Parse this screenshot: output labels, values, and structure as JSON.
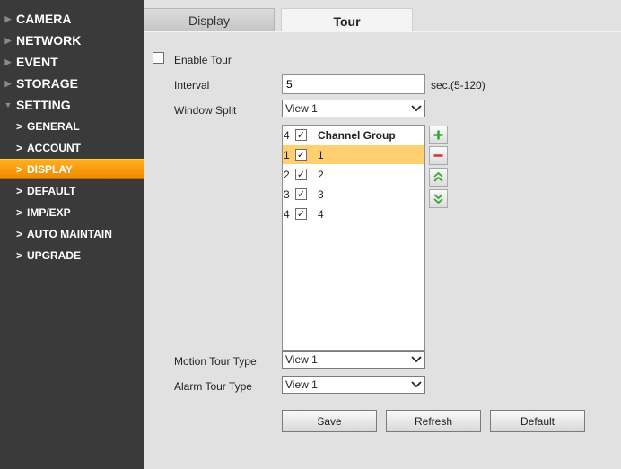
{
  "sidebar": {
    "top_items": [
      {
        "label": "CAMERA"
      },
      {
        "label": "NETWORK"
      },
      {
        "label": "EVENT"
      },
      {
        "label": "STORAGE"
      },
      {
        "label": "SETTING"
      }
    ],
    "sub_items": [
      {
        "label": "GENERAL"
      },
      {
        "label": "ACCOUNT"
      },
      {
        "label": "DISPLAY"
      },
      {
        "label": "DEFAULT"
      },
      {
        "label": "IMP/EXP"
      },
      {
        "label": "AUTO MAINTAIN"
      },
      {
        "label": "UPGRADE"
      }
    ],
    "active_sub": "DISPLAY",
    "active_color": "#f59a0a"
  },
  "tabs": {
    "display": "Display",
    "tour": "Tour",
    "active": "Tour"
  },
  "form": {
    "enable_tour": {
      "label": "Enable Tour",
      "checked": false
    },
    "interval": {
      "label": "Interval",
      "value": "5",
      "hint": "sec.(5-120)"
    },
    "window_split": {
      "label": "Window Split",
      "value": "View 1"
    },
    "motion_tour_type": {
      "label": "Motion Tour Type",
      "value": "View 1"
    },
    "alarm_tour_type": {
      "label": "Alarm Tour Type",
      "value": "View 1"
    }
  },
  "channel_list": {
    "header": {
      "num": "4",
      "checked": true,
      "label": "Channel Group"
    },
    "rows": [
      {
        "num": "1",
        "checked": true,
        "label": "1",
        "selected": true
      },
      {
        "num": "2",
        "checked": true,
        "label": "2",
        "selected": false
      },
      {
        "num": "3",
        "checked": true,
        "label": "3",
        "selected": false
      },
      {
        "num": "4",
        "checked": true,
        "label": "4",
        "selected": false
      }
    ]
  },
  "list_controls": {
    "add": "plus-icon",
    "remove": "minus-icon",
    "move_up": "double-chevron-up-icon",
    "move_down": "double-chevron-down-icon"
  },
  "buttons": {
    "save": "Save",
    "refresh": "Refresh",
    "default": "Default"
  },
  "check_glyph": "✓"
}
